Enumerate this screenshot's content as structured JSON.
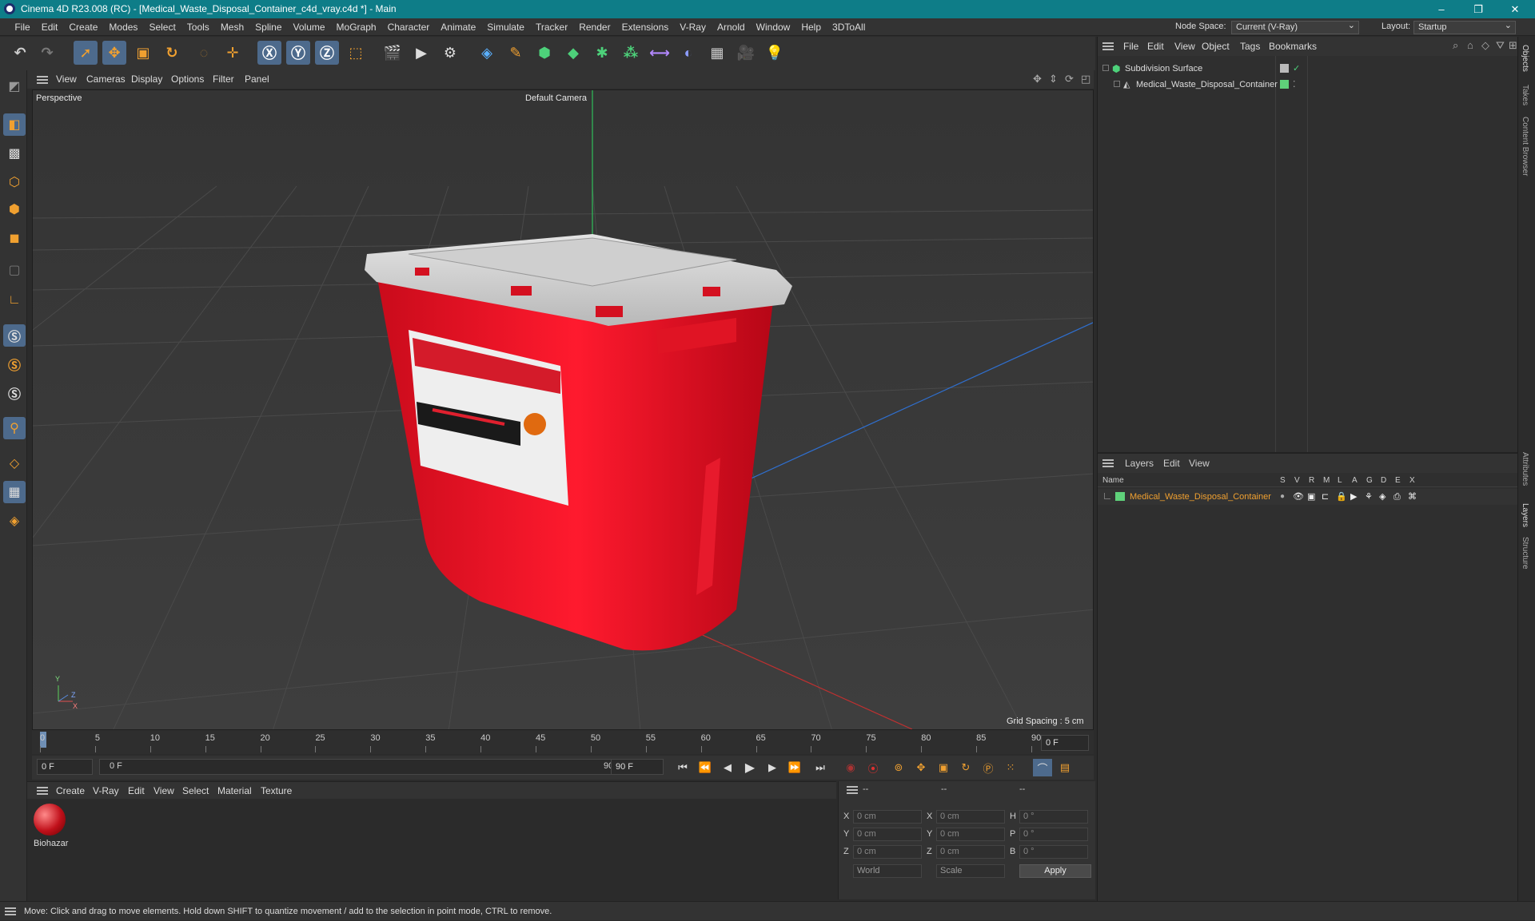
{
  "window": {
    "title": "Cinema 4D R23.008 (RC) - [Medical_Waste_Disposal_Container_c4d_vray.c4d *] - Main",
    "minimize": "–",
    "restore": "❐",
    "close": "✕"
  },
  "menubar": {
    "items": [
      "File",
      "Edit",
      "Create",
      "Modes",
      "Select",
      "Tools",
      "Mesh",
      "Spline",
      "Volume",
      "MoGraph",
      "Character",
      "Animate",
      "Simulate",
      "Tracker",
      "Render",
      "Extensions",
      "V-Ray",
      "Arnold",
      "Window",
      "Help",
      "3DToAll"
    ],
    "node_space_label": "Node Space:",
    "node_space_value": "Current (V-Ray)",
    "layout_label": "Layout:",
    "layout_value": "Startup"
  },
  "viewport": {
    "menu": [
      "View",
      "Cameras",
      "Display",
      "Options",
      "Filter",
      "Panel"
    ],
    "view_name": "Perspective",
    "camera": "Default Camera",
    "grid_spacing": "Grid Spacing : 5 cm",
    "axis_y": "Y",
    "axis_z": "Z",
    "axis_x": "X"
  },
  "timeline": {
    "ticks": [
      "0",
      "5",
      "10",
      "15",
      "20",
      "25",
      "30",
      "35",
      "40",
      "45",
      "50",
      "55",
      "60",
      "65",
      "70",
      "75",
      "80",
      "85",
      "90"
    ],
    "end_field": "0 F"
  },
  "playbar": {
    "current_frame": "0 F",
    "range_start": "0 F",
    "range_end": "90 F",
    "max_frame": "90 F"
  },
  "material_manager": {
    "menu": [
      "Create",
      "V-Ray",
      "Edit",
      "View",
      "Select",
      "Material",
      "Texture"
    ],
    "material_name": "Biohazar"
  },
  "coordinates": {
    "headers": [
      "--",
      "--",
      "--"
    ],
    "rows": [
      {
        "a": "X",
        "av": "0 cm",
        "b": "X",
        "bv": "0 cm",
        "c": "H",
        "cv": "0 °"
      },
      {
        "a": "Y",
        "av": "0 cm",
        "b": "Y",
        "bv": "0 cm",
        "c": "P",
        "cv": "0 °"
      },
      {
        "a": "Z",
        "av": "0 cm",
        "b": "Z",
        "bv": "0 cm",
        "c": "B",
        "cv": "0 °"
      }
    ],
    "mode1": "World",
    "mode2": "Scale",
    "apply": "Apply"
  },
  "object_manager": {
    "menu": [
      "File",
      "Edit",
      "View",
      "Object",
      "Tags",
      "Bookmarks"
    ],
    "objects": [
      {
        "name": "Subdivision Surface"
      },
      {
        "name": "Medical_Waste_Disposal_Container"
      }
    ]
  },
  "layer_manager": {
    "menu": [
      "Layers",
      "Edit",
      "View"
    ],
    "name_header": "Name",
    "flags": [
      "S",
      "V",
      "R",
      "M",
      "L",
      "A",
      "G",
      "D",
      "E",
      "X"
    ],
    "layers": [
      {
        "name": "Medical_Waste_Disposal_Container",
        "color": "#5fd17a"
      }
    ]
  },
  "right_tabs": [
    "Objects",
    "Takes",
    "Content Browser",
    "Attributes",
    "Layers",
    "Structure"
  ],
  "status": "Move: Click and drag to move elements. Hold down SHIFT to quantize movement / add to the selection in point mode, CTRL to remove.",
  "colors": {
    "accent": "#0e7d88",
    "selection": "#4d6a8c",
    "highlight": "#f0a030",
    "layer_green": "#5fd17a"
  }
}
